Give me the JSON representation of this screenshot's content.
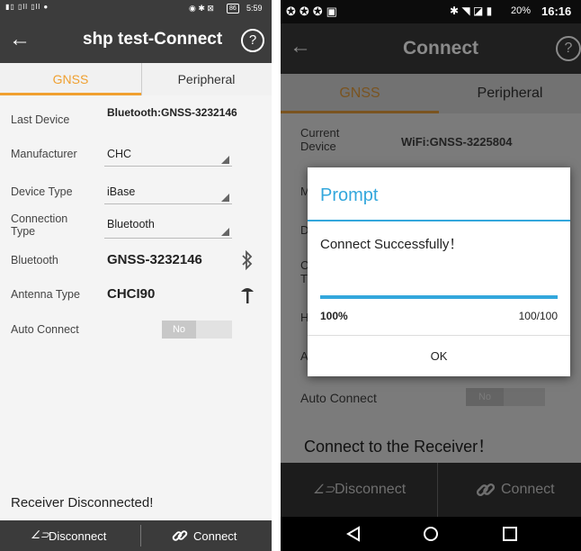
{
  "left": {
    "status": {
      "time": "5:59",
      "battery": "86"
    },
    "title": "shp test-Connect",
    "help": "?",
    "tabs": [
      "GNSS",
      "Peripheral"
    ],
    "fields": {
      "last_device": {
        "label": "Last Device",
        "value": "Bluetooth:GNSS-3232146"
      },
      "manufacturer": {
        "label": "Manufacturer",
        "value": "CHC"
      },
      "device_type": {
        "label": "Device Type",
        "value": "iBase"
      },
      "connection_type": {
        "label": "Connection Type",
        "value": "Bluetooth"
      },
      "bluetooth": {
        "label": "Bluetooth",
        "value": "GNSS-3232146"
      },
      "antenna_type": {
        "label": "Antenna Type",
        "value": "CHCI90"
      },
      "auto_connect": {
        "label": "Auto Connect",
        "value": "No"
      }
    },
    "status_message": "Receiver Disconnected!",
    "buttons": {
      "disconnect": "Disconnect",
      "connect": "Connect"
    },
    "colors": {
      "accent": "#f0a030",
      "bar": "#3c3c3c"
    }
  },
  "right": {
    "status": {
      "battery": "20%",
      "time": "16:16"
    },
    "title": "Connect",
    "help": "?",
    "tabs": [
      "GNSS",
      "Peripheral"
    ],
    "current_device": {
      "label": "Current Device",
      "value": "WiFi:GNSS-3225804"
    },
    "auto_connect": {
      "label": "Auto Connect",
      "value": "No"
    },
    "connect_msg": "Connect to the Receiver！",
    "dialog": {
      "title": "Prompt",
      "message": "Connect Successfully！",
      "progress": 1.0,
      "percent": "100%",
      "count": "100/100",
      "ok": "OK"
    },
    "buttons": {
      "disconnect": "Disconnect",
      "connect": "Connect"
    },
    "colors": {
      "accent": "#33a7dc"
    }
  }
}
